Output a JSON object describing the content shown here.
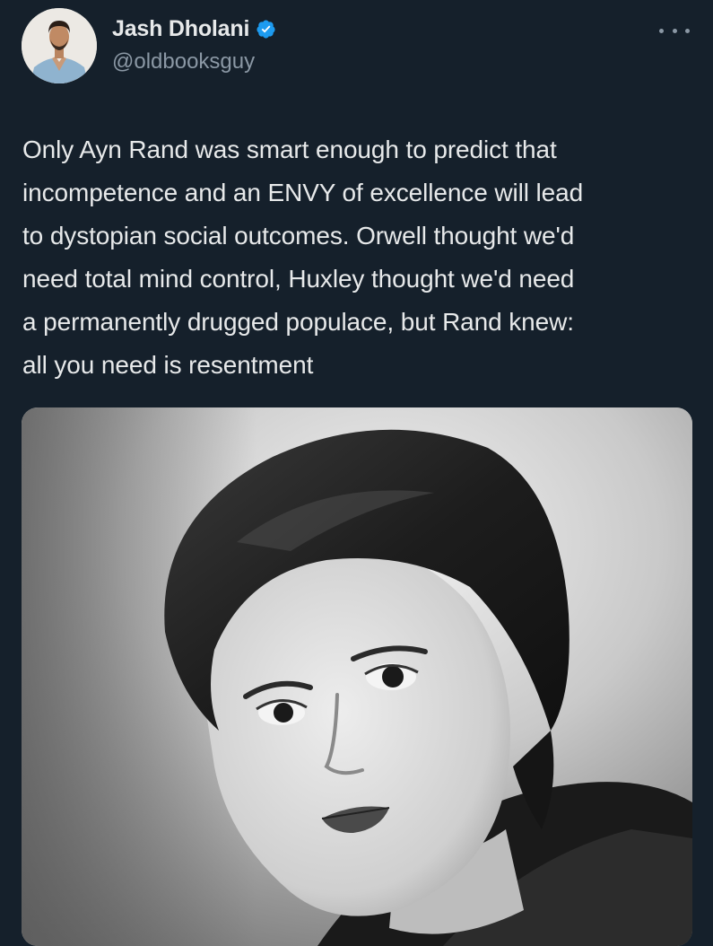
{
  "author": {
    "display_name": "Jash Dholani",
    "handle": "@oldbooksguy",
    "verified": true,
    "avatar_icon": "profile-photo"
  },
  "tweet": {
    "text": "Only Ayn Rand was smart enough to predict that\nincompetence and an ENVY of excellence will lead\nto dystopian social outcomes. Orwell thought we'd\nneed total mind control, Huxley thought we'd need\na permanently drugged populace, but Rand knew:\nall you need is resentment"
  },
  "icons": {
    "verified": "verified-badge-icon",
    "more": "more-options-icon"
  },
  "colors": {
    "background": "#15202b",
    "text": "#e7e9ea",
    "secondary": "#8b98a5",
    "verified": "#1d9bf0"
  }
}
